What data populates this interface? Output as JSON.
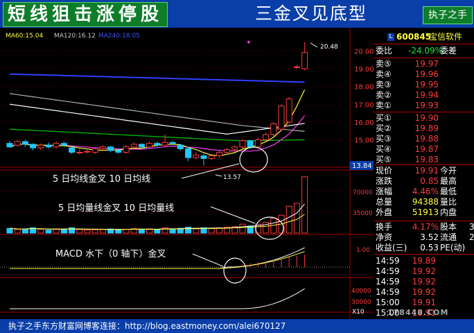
{
  "header": {
    "title_left": "短线狙击涨停股",
    "title_center": "三金叉见底型",
    "title_right": "执子之手"
  },
  "ma_legend": {
    "ma60": "MA60:15.04",
    "ma120": "MA120:16.12",
    "ma240": "MA240:18.05"
  },
  "price_axis": [
    "20.00",
    "19.00",
    "18.00",
    "17.00",
    "16.00",
    "15.00"
  ],
  "price_current": "13.84",
  "high_label": "20.48",
  "low_label": "13.57",
  "volume_axis": [
    "70000",
    "35000"
  ],
  "macd_axis": [
    "1.00"
  ],
  "lower_axis": [
    "40000",
    "30000"
  ],
  "lower_unit": "X10",
  "annotations": {
    "ma_cross": "5 日均线金叉 10 日均线",
    "vol_cross": "5 日均量线金叉 10 日均量线",
    "macd_cross": "MACD 水下（0 轴下）金叉"
  },
  "quote": {
    "badge": "L",
    "code": "600845",
    "name": "宝信软件",
    "weibi_label": "委比",
    "weibi_value": "-24.09%",
    "weicha_label": "委差",
    "sells": [
      {
        "label": "卖⑤",
        "price": "19.97"
      },
      {
        "label": "卖④",
        "price": "19.96"
      },
      {
        "label": "卖③",
        "price": "19.95"
      },
      {
        "label": "卖②",
        "price": "19.94"
      },
      {
        "label": "卖①",
        "price": "19.93"
      }
    ],
    "buys": [
      {
        "label": "买①",
        "price": "19.90"
      },
      {
        "label": "买②",
        "price": "19.89"
      },
      {
        "label": "买③",
        "price": "19.88"
      },
      {
        "label": "买④",
        "price": "19.87"
      },
      {
        "label": "买⑤",
        "price": "19.83"
      }
    ],
    "stats": [
      {
        "label": "现价",
        "value": "19.91",
        "label2": "今开"
      },
      {
        "label": "涨跌",
        "value": "0.85",
        "label2": "最高"
      },
      {
        "label": "涨幅",
        "value": "4.46%",
        "label2": "最低"
      },
      {
        "label": "总量",
        "value": "94388",
        "label2": "量比"
      },
      {
        "label": "外盘",
        "value": "51913",
        "label2": "内盘"
      }
    ],
    "stats2": [
      {
        "label": "换手",
        "value": "4.17%",
        "label2": "股本",
        "extra": "3"
      },
      {
        "label": "净资",
        "value": "3.52",
        "label2": "流通",
        "extra": "2"
      },
      {
        "label": "收益(三)",
        "value": "0.53",
        "label2": "PE(动)",
        "extra": ""
      }
    ],
    "ticks": [
      {
        "time": "14:59",
        "price": "19.89"
      },
      {
        "time": "14:59",
        "price": "19.92"
      },
      {
        "time": "14:59",
        "price": "19.92"
      },
      {
        "time": "14:59",
        "price": "19.92"
      },
      {
        "time": "15:00",
        "price": "19.91"
      },
      {
        "time": "15:00",
        "price": "19.91"
      }
    ]
  },
  "watermark": "178448.COM",
  "footer": "执子之手东方财富网博客连接：http://blog.eastmoney.com/alei670127",
  "colors": {
    "up": "#ff3b3b",
    "down": "#20c8ff",
    "ma_white": "#ffffff",
    "ma_yellow": "#ffff40",
    "ma_magenta": "#ff40ff",
    "ma60": "#00c800",
    "ma120": "#b0b0b0",
    "ma240": "#3040ff",
    "grid": "#a00000"
  },
  "chart_data": {
    "type": "candlestick",
    "candles": [
      {
        "o": 14.8,
        "c": 14.6,
        "h": 14.95,
        "l": 14.55
      },
      {
        "o": 14.7,
        "c": 14.9,
        "h": 15.0,
        "l": 14.6
      },
      {
        "o": 14.9,
        "c": 14.75,
        "h": 15.0,
        "l": 14.6
      },
      {
        "o": 14.75,
        "c": 14.55,
        "h": 14.8,
        "l": 14.4
      },
      {
        "o": 14.55,
        "c": 14.7,
        "h": 14.8,
        "l": 14.45
      },
      {
        "o": 14.7,
        "c": 14.6,
        "h": 14.85,
        "l": 14.5
      },
      {
        "o": 14.6,
        "c": 14.8,
        "h": 14.9,
        "l": 14.5
      },
      {
        "o": 14.8,
        "c": 14.7,
        "h": 14.9,
        "l": 14.6
      },
      {
        "o": 14.55,
        "c": 14.3,
        "h": 14.6,
        "l": 14.2
      },
      {
        "o": 14.3,
        "c": 14.3,
        "h": 14.5,
        "l": 14.2
      },
      {
        "o": 14.35,
        "c": 14.35,
        "h": 14.5,
        "l": 14.25
      },
      {
        "o": 14.3,
        "c": 14.5,
        "h": 14.6,
        "l": 14.2
      },
      {
        "o": 14.5,
        "c": 14.6,
        "h": 14.7,
        "l": 14.4
      },
      {
        "o": 14.6,
        "c": 14.4,
        "h": 14.65,
        "l": 14.3
      },
      {
        "o": 14.4,
        "c": 14.3,
        "h": 14.5,
        "l": 14.2
      },
      {
        "o": 14.3,
        "c": 14.6,
        "h": 14.7,
        "l": 14.2
      },
      {
        "o": 14.6,
        "c": 14.75,
        "h": 14.85,
        "l": 14.5
      },
      {
        "o": 14.75,
        "c": 14.6,
        "h": 14.8,
        "l": 14.5
      },
      {
        "o": 14.6,
        "c": 14.8,
        "h": 14.9,
        "l": 14.5
      },
      {
        "o": 14.8,
        "c": 14.7,
        "h": 14.9,
        "l": 14.6
      },
      {
        "o": 14.7,
        "c": 14.85,
        "h": 15.3,
        "l": 14.6
      },
      {
        "o": 14.85,
        "c": 14.8,
        "h": 14.95,
        "l": 14.7
      },
      {
        "o": 14.7,
        "c": 14.5,
        "h": 14.75,
        "l": 14.4
      },
      {
        "o": 14.5,
        "c": 14.0,
        "h": 14.6,
        "l": 13.8
      },
      {
        "o": 14.0,
        "c": 14.15,
        "h": 14.3,
        "l": 13.9
      },
      {
        "o": 14.1,
        "c": 13.95,
        "h": 14.2,
        "l": 13.57
      },
      {
        "o": 13.95,
        "c": 14.1,
        "h": 14.2,
        "l": 13.85
      },
      {
        "o": 14.1,
        "c": 14.3,
        "h": 14.4,
        "l": 14.0
      },
      {
        "o": 14.3,
        "c": 14.45,
        "h": 14.55,
        "l": 14.2
      },
      {
        "o": 14.45,
        "c": 14.6,
        "h": 14.7,
        "l": 14.35
      },
      {
        "o": 14.6,
        "c": 14.95,
        "h": 15.05,
        "l": 14.5
      },
      {
        "o": 14.95,
        "c": 14.6,
        "h": 15.0,
        "l": 14.5
      },
      {
        "o": 14.6,
        "c": 15.0,
        "h": 15.1,
        "l": 14.5
      },
      {
        "o": 15.0,
        "c": 15.3,
        "h": 15.4,
        "l": 14.9
      },
      {
        "o": 15.3,
        "c": 15.9,
        "h": 16.0,
        "l": 15.2
      },
      {
        "o": 15.6,
        "c": 16.9,
        "h": 17.0,
        "l": 15.5
      },
      {
        "o": 16.0,
        "c": 17.3,
        "h": 17.4,
        "l": 15.9
      },
      {
        "o": 19.1,
        "c": 19.1,
        "h": 19.2,
        "l": 19.0
      },
      {
        "o": 19.0,
        "c": 19.91,
        "h": 20.48,
        "l": 18.9
      }
    ],
    "volumes": [
      8000,
      6000,
      7000,
      9000,
      6500,
      5000,
      6000,
      7000,
      9000,
      6000,
      5000,
      5500,
      6000,
      7000,
      6500,
      6000,
      7500,
      6500,
      7000,
      6000,
      9000,
      7000,
      8000,
      10000,
      7000,
      9000,
      8000,
      9000,
      10000,
      11000,
      15000,
      12000,
      15000,
      18000,
      25000,
      30000,
      45000,
      50000,
      94388
    ],
    "ylim": [
      13.5,
      20.6
    ],
    "vol_ylim": [
      0,
      100000
    ]
  }
}
